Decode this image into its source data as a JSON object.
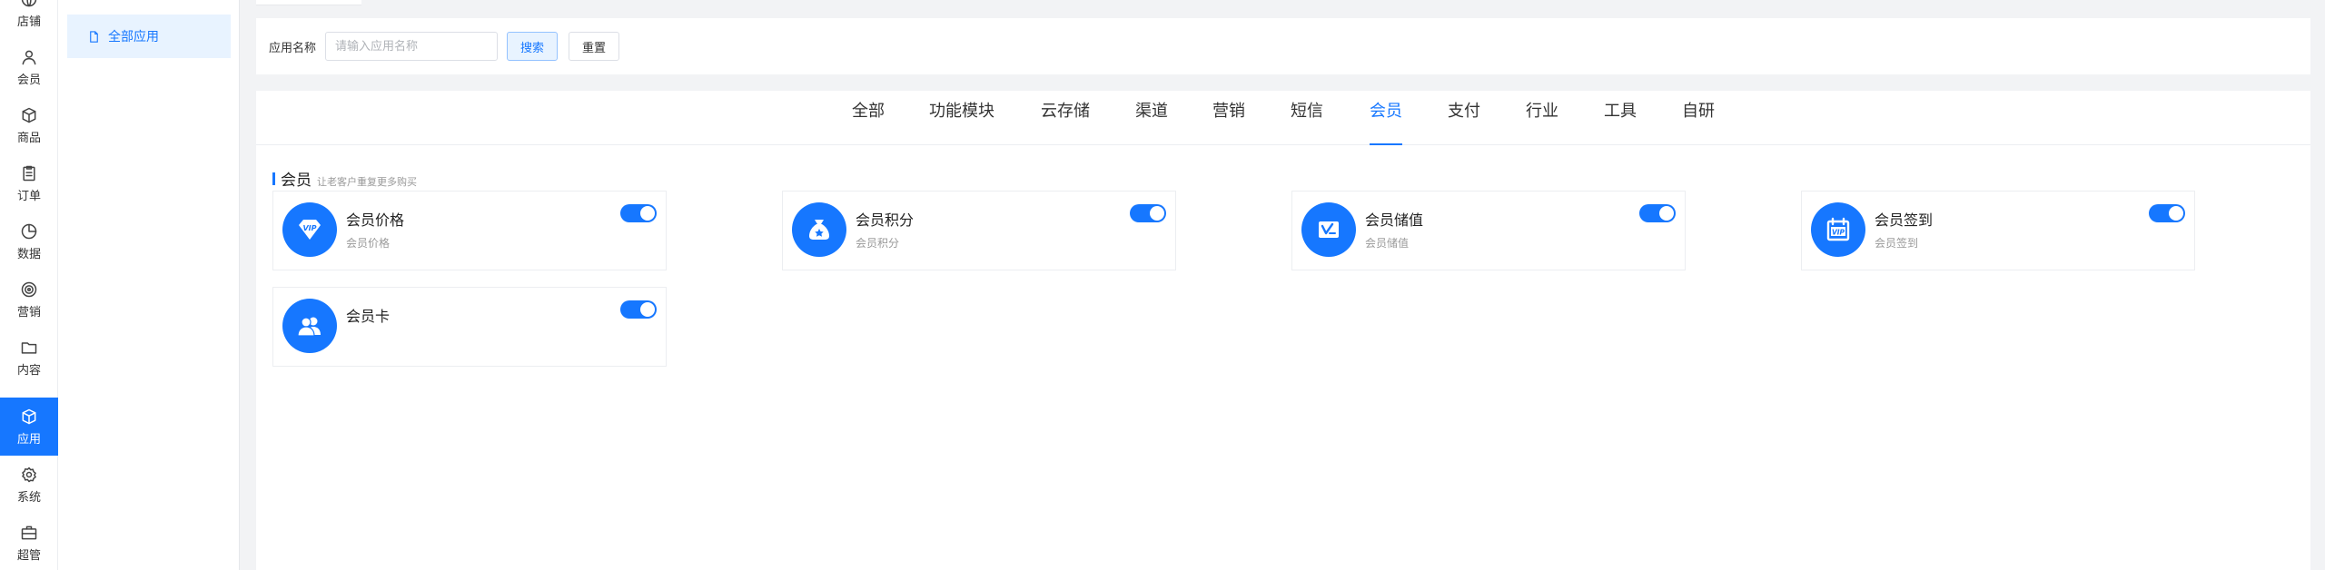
{
  "rail": {
    "items": [
      {
        "label": "店铺",
        "icon": "globe-icon"
      },
      {
        "label": "会员",
        "icon": "user-icon"
      },
      {
        "label": "商品",
        "icon": "box-icon"
      },
      {
        "label": "订单",
        "icon": "clipboard-icon"
      },
      {
        "label": "数据",
        "icon": "pie-chart-icon"
      },
      {
        "label": "营销",
        "icon": "target-icon"
      },
      {
        "label": "内容",
        "icon": "folder-icon"
      },
      {
        "label": "应用",
        "icon": "cube-icon",
        "active": true
      },
      {
        "label": "系统",
        "icon": "gear-icon"
      },
      {
        "label": "超管",
        "icon": "briefcase-icon"
      }
    ]
  },
  "submenu": {
    "items": [
      {
        "label": "全部应用",
        "icon": "document-icon",
        "active": true
      }
    ]
  },
  "filter": {
    "label": "应用名称",
    "input_placeholder": "请输入应用名称",
    "input_value": "",
    "search_label": "搜索",
    "reset_label": "重置"
  },
  "tabs": {
    "items": [
      "全部",
      "功能模块",
      "云存储",
      "渠道",
      "营销",
      "短信",
      "会员",
      "支付",
      "行业",
      "工具",
      "自研"
    ],
    "active": "会员"
  },
  "section": {
    "title": "会员",
    "subtitle": "让老客户重复更多购买"
  },
  "cards": [
    {
      "title": "会员价格",
      "desc": "会员价格",
      "icon": "vip-diamond-icon",
      "enabled": true
    },
    {
      "title": "会员积分",
      "desc": "会员积分",
      "icon": "money-bag-icon",
      "enabled": true
    },
    {
      "title": "会员储值",
      "desc": "会员储值",
      "icon": "stored-value-card-icon",
      "enabled": true
    },
    {
      "title": "会员签到",
      "desc": "会员签到",
      "icon": "vip-calendar-icon",
      "enabled": true
    },
    {
      "title": "会员卡",
      "desc": "",
      "icon": "members-icon",
      "enabled": true
    }
  ],
  "colors": {
    "accent": "#1677ff",
    "accent_light": "#e8f3ff",
    "background": "#f2f3f5"
  }
}
